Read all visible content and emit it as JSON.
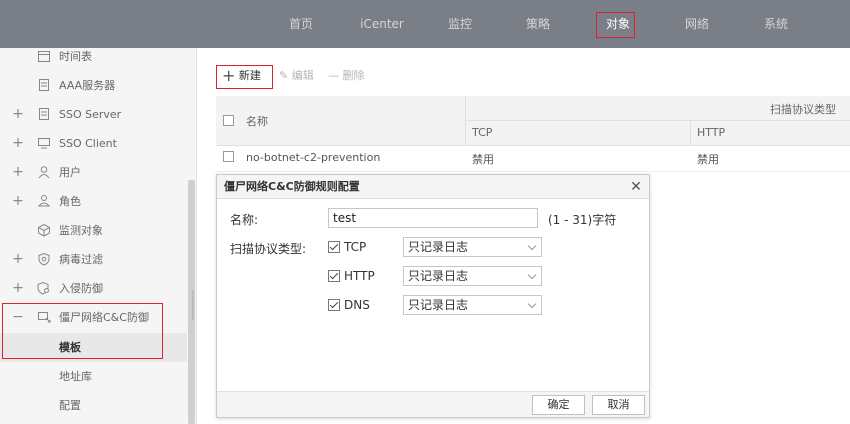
{
  "topnav": [
    {
      "label": "首页",
      "active": false
    },
    {
      "label": "iCenter",
      "active": false
    },
    {
      "label": "监控",
      "active": false
    },
    {
      "label": "策略",
      "active": false
    },
    {
      "label": "对象",
      "active": true
    },
    {
      "label": "网络",
      "active": false
    },
    {
      "label": "系统",
      "active": false
    }
  ],
  "sidebar": {
    "items": [
      {
        "label": "时间表",
        "expander": "",
        "icon": "calendar-icon"
      },
      {
        "label": "AAA服务器",
        "expander": "",
        "icon": "server-icon"
      },
      {
        "label": "SSO Server",
        "expander": "+",
        "icon": "server-icon"
      },
      {
        "label": "SSO Client",
        "expander": "+",
        "icon": "monitor-icon"
      },
      {
        "label": "用户",
        "expander": "+",
        "icon": "user-icon"
      },
      {
        "label": "角色",
        "expander": "+",
        "icon": "role-icon"
      },
      {
        "label": "监测对象",
        "expander": "",
        "icon": "cube-icon"
      },
      {
        "label": "病毒过滤",
        "expander": "+",
        "icon": "shield-icon"
      },
      {
        "label": "入侵防御",
        "expander": "+",
        "icon": "shield-search-icon"
      },
      {
        "label": "僵尸网络C&C防御",
        "expander": "−",
        "icon": "botnet-icon"
      }
    ],
    "subitems": [
      {
        "label": "模板",
        "selected": true
      },
      {
        "label": "地址库",
        "selected": false
      },
      {
        "label": "配置",
        "selected": false
      }
    ]
  },
  "toolbar": {
    "new_label": "新建",
    "edit_label": "编辑",
    "delete_label": "删除"
  },
  "grid": {
    "col_name": "名称",
    "col_group": "扫描协议类型",
    "col_tcp": "TCP",
    "col_http": "HTTP",
    "row": {
      "name": "no-botnet-c2-prevention",
      "tcp": "禁用",
      "http": "禁用"
    }
  },
  "dialog": {
    "title": "僵尸网络C&C防御规则配置",
    "name_label": "名称:",
    "name_value": "test",
    "name_hint": "(1 - 31)字符",
    "protocol_label": "扫描协议类型:",
    "protocols": [
      {
        "label": "TCP",
        "checked": true,
        "action": "只记录日志"
      },
      {
        "label": "HTTP",
        "checked": true,
        "action": "只记录日志"
      },
      {
        "label": "DNS",
        "checked": true,
        "action": "只记录日志"
      }
    ],
    "ok_label": "确定",
    "cancel_label": "取消"
  },
  "colors": {
    "topbar": "#7a7f87",
    "highlight": "#d9232e",
    "sidebar_bg": "#f5f5f5"
  }
}
